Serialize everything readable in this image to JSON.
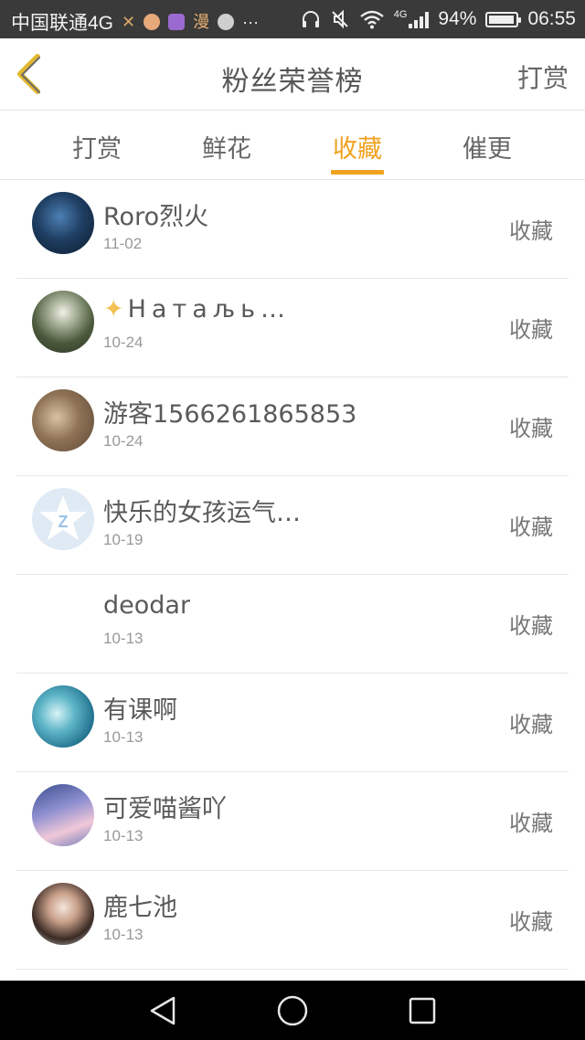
{
  "status_bar": {
    "carrier": "中国联通4G",
    "network": "4G",
    "battery": "94%",
    "time": "06:55"
  },
  "header": {
    "title": "粉丝荣誉榜",
    "right_button": "打赏",
    "back_icon": "chevron-left-icon"
  },
  "tabs": [
    {
      "label": "打赏",
      "active": false
    },
    {
      "label": "鲜花",
      "active": false
    },
    {
      "label": "收藏",
      "active": true
    },
    {
      "label": "催更",
      "active": false
    }
  ],
  "fans": [
    {
      "name": "Roro烈火",
      "date": "11-02",
      "action": "收藏"
    },
    {
      "name": "Натаљь…",
      "date": "10-24",
      "action": "收藏"
    },
    {
      "name": "游客1566261865853",
      "date": "10-24",
      "action": "收藏"
    },
    {
      "name": "快乐的女孩运气…",
      "date": "10-19",
      "action": "收藏"
    },
    {
      "name": "deodar",
      "date": "10-13",
      "action": "收藏"
    },
    {
      "name": "有课啊",
      "date": "10-13",
      "action": "收藏"
    },
    {
      "name": "可爱喵酱吖",
      "date": "10-13",
      "action": "收藏"
    },
    {
      "name": "鹿七池",
      "date": "10-13",
      "action": "收藏"
    }
  ],
  "colors": {
    "accent": "#f0a21f",
    "status_bar_bg": "#3a3a3a",
    "divider": "#e6e6e6"
  }
}
